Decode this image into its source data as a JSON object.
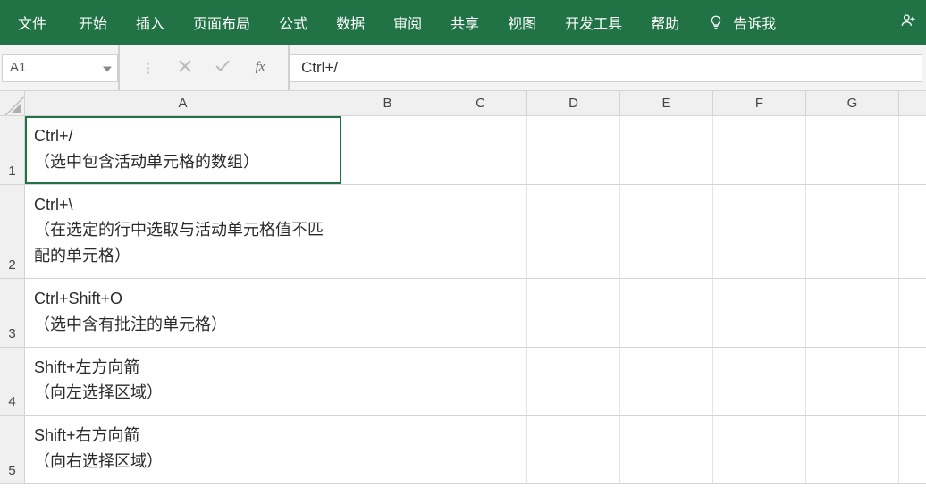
{
  "ribbon": {
    "tabs": [
      "文件",
      "开始",
      "插入",
      "页面布局",
      "公式",
      "数据",
      "审阅",
      "共享",
      "视图",
      "开发工具",
      "帮助"
    ],
    "tell_me_label": "告诉我"
  },
  "formula_bar": {
    "name_box_value": "A1",
    "fx_label": "fx",
    "formula_value": "Ctrl+/"
  },
  "grid": {
    "columns": [
      "A",
      "B",
      "C",
      "D",
      "E",
      "F",
      "G"
    ],
    "rows": [
      {
        "num": "1",
        "A": "Ctrl+/\n（选中包含活动单元格的数组）"
      },
      {
        "num": "2",
        "A": "Ctrl+\\\n（在选定的行中选取与活动单元格值不匹配的单元格）"
      },
      {
        "num": "3",
        "A": "Ctrl+Shift+O\n（选中含有批注的单元格）"
      },
      {
        "num": "4",
        "A": "Shift+左方向箭\n（向左选择区域）"
      },
      {
        "num": "5",
        "A": "Shift+右方向箭\n（向右选择区域）"
      }
    ],
    "selected_cell": "A1"
  }
}
